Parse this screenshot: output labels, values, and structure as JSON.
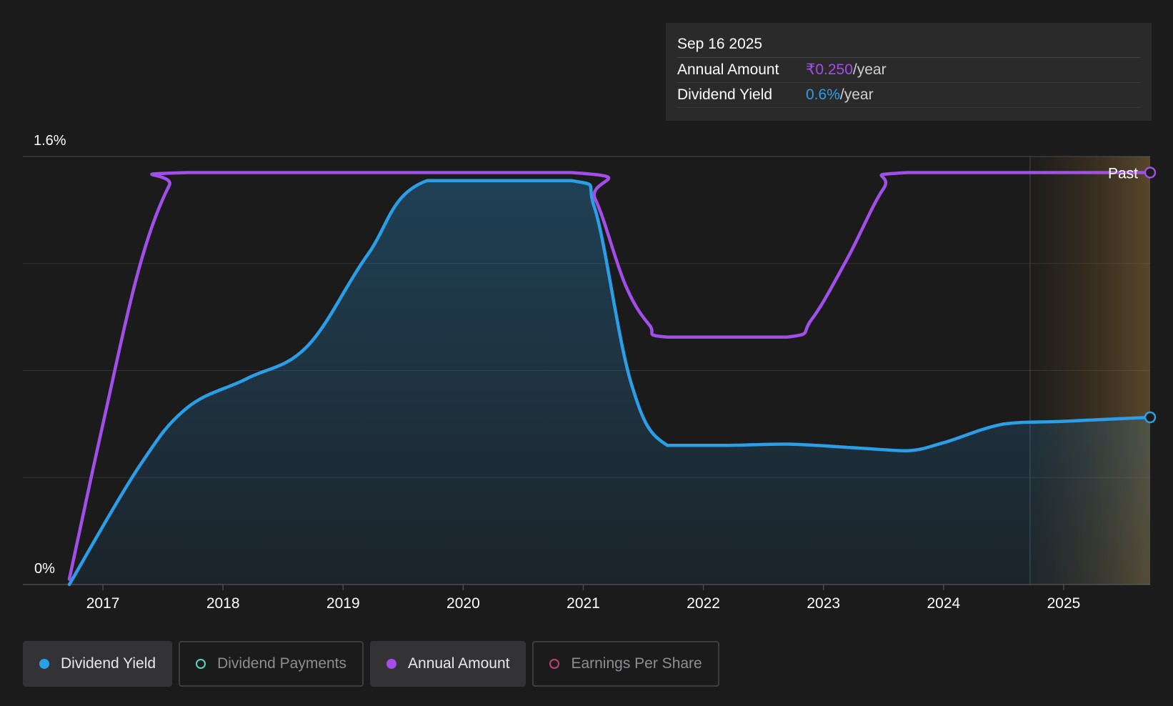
{
  "tooltip": {
    "date": "Sep 16 2025",
    "rows": [
      {
        "label": "Annual Amount",
        "value": "₹0.250",
        "unit": "/year",
        "color": "#a24ee8"
      },
      {
        "label": "Dividend Yield",
        "value": "0.6%",
        "unit": "/year",
        "color": "#2a9fe8"
      }
    ]
  },
  "legend": [
    {
      "label": "Dividend Yield",
      "color": "#2a9fe8",
      "active": true,
      "filled": true
    },
    {
      "label": "Dividend Payments",
      "color": "#5fd3c3",
      "active": false,
      "filled": false
    },
    {
      "label": "Annual Amount",
      "color": "#a24ee8",
      "active": true,
      "filled": true
    },
    {
      "label": "Earnings Per Share",
      "color": "#c63f7c",
      "active": false,
      "filled": false
    }
  ],
  "chart_data": {
    "type": "line",
    "y_tick_labels": [
      "1.6%",
      "0%"
    ],
    "ylim": [
      0,
      1.6
    ],
    "y_unit": "%",
    "x_tick_labels": [
      "2017",
      "2018",
      "2019",
      "2020",
      "2021",
      "2022",
      "2023",
      "2024",
      "2025"
    ],
    "xlim": [
      2016.72,
      2025.72
    ],
    "past_region_start": 2024.72,
    "past_label": "Past",
    "grid": true,
    "series": [
      {
        "name": "Dividend Yield",
        "color": "#2a9fe8",
        "filled": true,
        "points": [
          [
            2016.72,
            0.0
          ],
          [
            2017.3,
            0.44
          ],
          [
            2017.7,
            0.66
          ],
          [
            2018.2,
            0.77
          ],
          [
            2018.7,
            0.89
          ],
          [
            2019.2,
            1.23
          ],
          [
            2019.7,
            1.51
          ],
          [
            2020.9,
            1.51
          ],
          [
            2021.1,
            1.4
          ],
          [
            2021.4,
            0.75
          ],
          [
            2021.7,
            0.52
          ],
          [
            2022.2,
            0.52
          ],
          [
            2022.7,
            0.525
          ],
          [
            2023.3,
            0.51
          ],
          [
            2023.7,
            0.5
          ],
          [
            2024.0,
            0.53
          ],
          [
            2024.5,
            0.6
          ],
          [
            2025.0,
            0.61
          ],
          [
            2025.72,
            0.625
          ]
        ]
      },
      {
        "name": "Annual Amount",
        "color": "#a24ee8",
        "filled": false,
        "points": [
          [
            2016.72,
            0.02
          ],
          [
            2017.0,
            0.6
          ],
          [
            2017.3,
            1.18
          ],
          [
            2017.55,
            1.49
          ],
          [
            2017.7,
            1.54
          ],
          [
            2020.9,
            1.54
          ],
          [
            2021.1,
            1.44
          ],
          [
            2021.35,
            1.12
          ],
          [
            2021.55,
            0.97
          ],
          [
            2021.7,
            0.925
          ],
          [
            2022.7,
            0.925
          ],
          [
            2022.9,
            0.99
          ],
          [
            2023.2,
            1.22
          ],
          [
            2023.5,
            1.48
          ],
          [
            2023.7,
            1.54
          ],
          [
            2025.72,
            1.54
          ]
        ]
      }
    ]
  }
}
